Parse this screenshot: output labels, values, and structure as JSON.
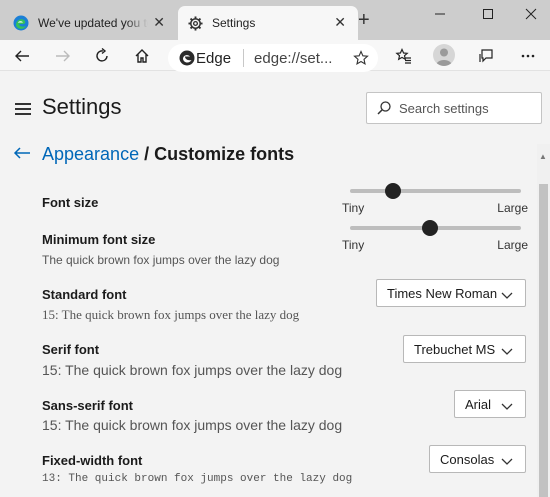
{
  "tabs": [
    {
      "title": "We've updated you to the latest",
      "active": false,
      "icon": "edge-logo-icon"
    },
    {
      "title": "Settings",
      "active": true,
      "icon": "gear-icon"
    }
  ],
  "tab_close_glyph": "✕",
  "new_tab_glyph": "+",
  "window_controls": {
    "minimize": "—",
    "restore": "☐",
    "close": "✕"
  },
  "address_bar": {
    "site_label": "Edge",
    "url": "edge://set..."
  },
  "settings": {
    "title": "Settings",
    "search_placeholder": "Search settings"
  },
  "breadcrumb": {
    "parent": "Appearance",
    "separator": "/",
    "current": "Customize fonts"
  },
  "font_size": {
    "label": "Font size",
    "min_label": "Tiny",
    "max_label": "Large",
    "level_fraction": 0.25
  },
  "min_font_size": {
    "label": "Minimum font size",
    "sample": "The quick brown fox jumps over the lazy dog",
    "min_label": "Tiny",
    "max_label": "Large",
    "level_fraction": 0.47
  },
  "fonts": [
    {
      "label": "Standard font",
      "sample": "15: The quick brown fox jumps over the lazy dog",
      "selected": "Times New Roman"
    },
    {
      "label": "Serif font",
      "sample": "15: The quick brown fox jumps over the lazy dog",
      "selected": "Trebuchet MS"
    },
    {
      "label": "Sans-serif font",
      "sample": "15: The quick brown fox jumps over the lazy dog",
      "selected": "Arial"
    },
    {
      "label": "Fixed-width font",
      "sample": "13: The quick brown fox jumps over the lazy dog",
      "selected": "Consolas"
    }
  ],
  "colors": {
    "accent": "#0067b8",
    "edge_blue": "#1b7fd6",
    "edge_green": "#35c159"
  }
}
